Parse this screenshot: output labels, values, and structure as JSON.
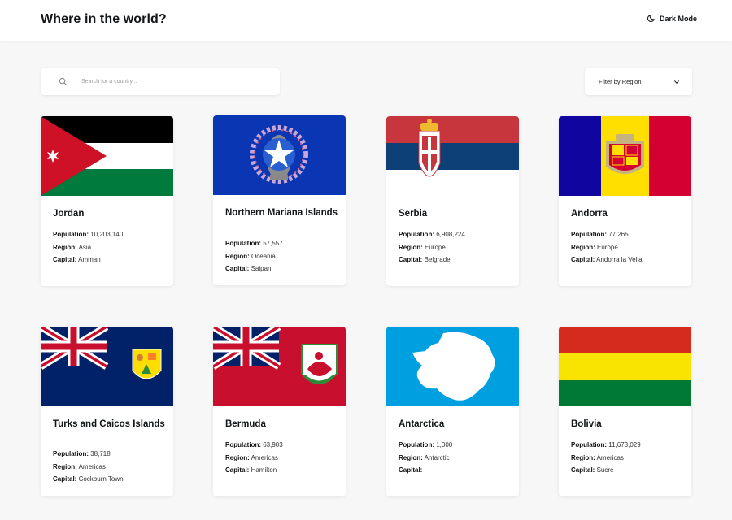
{
  "header": {
    "title": "Where in the world?",
    "dark_mode_label": "Dark Mode"
  },
  "search": {
    "placeholder": "Search for a country...",
    "value": ""
  },
  "filter": {
    "label": "Filter by Region"
  },
  "labels": {
    "population": "Population:",
    "region": "Region:",
    "capital": "Capital:"
  },
  "countries": [
    {
      "name": "Jordan",
      "population": "10,203,140",
      "region": "Asia",
      "capital": "Amman"
    },
    {
      "name": "Northern Mariana Islands",
      "population": "57,557",
      "region": "Oceania",
      "capital": "Saipan"
    },
    {
      "name": "Serbia",
      "population": "6,908,224",
      "region": "Europe",
      "capital": "Belgrade"
    },
    {
      "name": "Andorra",
      "population": "77,265",
      "region": "Europe",
      "capital": "Andorra la Vella"
    },
    {
      "name": "Turks and Caicos Islands",
      "population": "38,718",
      "region": "Americas",
      "capital": "Cockburn Town"
    },
    {
      "name": "Bermuda",
      "population": "63,903",
      "region": "Americas",
      "capital": "Hamilton"
    },
    {
      "name": "Antarctica",
      "population": "1,000",
      "region": "Antarctic",
      "capital": ""
    },
    {
      "name": "Bolivia",
      "population": "11,673,029",
      "region": "Americas",
      "capital": "Sucre"
    }
  ]
}
